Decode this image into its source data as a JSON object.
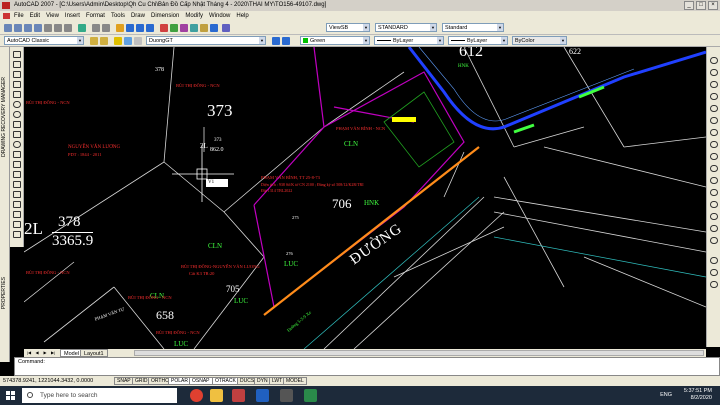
{
  "window": {
    "title": "AutoCAD 2007 - [C:\\Users\\Admin\\Desktop\\Qh Cu Chi\\Bản Đồ Cấp Nhật Tháng 4 - 2020\\THAI MY\\TO156-49107.dwg]"
  },
  "menu": {
    "items": [
      "File",
      "Edit",
      "View",
      "Insert",
      "Format",
      "Tools",
      "Draw",
      "Dimension",
      "Modify",
      "Window",
      "Help"
    ]
  },
  "toolbar": {
    "workspace": "AutoCAD Classic",
    "layer": "DuongGT",
    "color": "Green",
    "linetype": "ByLayer",
    "lineweight": "ByLayer",
    "plotstyle": "ByColor",
    "view": "ViewSB",
    "textstyle": "STANDARD",
    "dimstyle": "Standard"
  },
  "side_panels": {
    "drawing_recovery": "DRAWING RECOVERY MANAGER",
    "properties": "PROPERTIES"
  },
  "drawing": {
    "parcel_612": "612",
    "parcel_622": "622",
    "parcel_373": "373",
    "parcel_378_top": "378",
    "parcel_706": "706",
    "parcel_705": "705",
    "parcel_658": "658",
    "big_378": "378",
    "big_area": "3365.9",
    "big_prefix": "2L",
    "area_373": "862.0",
    "prefix_373": "2L",
    "hnk_top": "HNK",
    "hnk_mid": "HNK",
    "cln_1": "CLN",
    "cln_2": "CLN",
    "cln_3": "CLN",
    "luc_1": "LUC",
    "luc_2": "LUC",
    "luc_3": "LUC",
    "road": "ĐƯỜNG",
    "owner_1": "NGUYỄN VĂN LƯƠNG",
    "owner_1_sub": "PDT : 1844 - 2011",
    "owner_2": "PHẠM VĂN BÌNH - NCN",
    "owner_3": "PHẠM VĂN BÌNH, TT 25-8-73",
    "owner_3_line2": "Diện tích : 938 Số/K tờ CN 2100 ; Đăng ký số 508/12/K2R/TRI",
    "owner_3_line3": "Đất 1314 TBL2022",
    "owner_4": "BÙI THỊ ĐÔNG - NCN",
    "owner_5": "BÙI THỊ ĐÔNG-NGUYỄN VĂN LUONG",
    "owner_5_sub": "Cất K3 TR:20",
    "owner_6": "BÙI THỊ ĐÔNG - NCN",
    "owner_7": "BÙI THỊ ĐÔNG - NCN",
    "owner_8": "PHẠM VĂN TỰ",
    "road_label": "Đường 5-3-9 Xe",
    "small_276": "276",
    "small_275": "275",
    "cursor_label": "V1",
    "small_373b": "373"
  },
  "tabs": {
    "model": "Model",
    "layout1": "Layout1"
  },
  "command": {
    "line": "Command:"
  },
  "status": {
    "coords": "574378.9241, 1221044.3432, 0.0000",
    "buttons": [
      "SNAP",
      "GRID",
      "ORTHO",
      "POLAR",
      "OSNAP",
      "OTRACK",
      "DUCS",
      "DYN",
      "LWT",
      "MODEL"
    ]
  },
  "taskbar": {
    "search_placeholder": "Type here to search",
    "language": "ENG",
    "time": "5:37:51 PM",
    "date": "8/2/2020"
  },
  "colors": {
    "canvas_bg": "#000000",
    "parcel_line": "#ffffff",
    "boundary_magenta": "#c000c0",
    "road_orange": "#ff8c1a",
    "road_blue": "#2040ff",
    "label_green": "#40ff40",
    "owner_red": "#ff3030"
  }
}
